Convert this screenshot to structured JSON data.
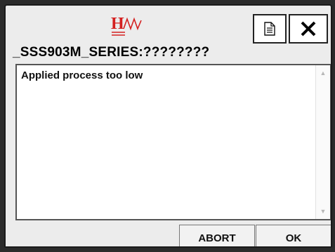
{
  "dialog": {
    "logo_letter": "H",
    "title": "_SSS903M_SERIES:????????",
    "message": "Applied process too low",
    "buttons": {
      "abort_label": "ABORT",
      "ok_label": "OK"
    },
    "icons": {
      "document": "document-icon",
      "close": "close-icon",
      "scroll_up": "scroll-up-arrow-icon",
      "scroll_down": "scroll-down-arrow-icon"
    },
    "colors": {
      "logo_red": "#d42020",
      "text": "#111111",
      "background": "#ececec"
    }
  }
}
